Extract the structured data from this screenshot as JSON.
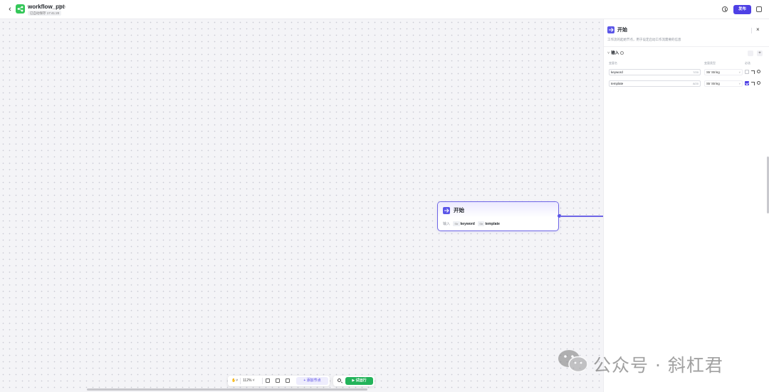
{
  "header": {
    "back_icon": "chevron-left-icon",
    "workflow_name": "workflow_ppt",
    "autosave_text": "已自动保存 17:41:20",
    "publish_label": "发布",
    "colors": {
      "publish": "#4e40e5",
      "app_icon": "#34c759"
    }
  },
  "canvas": {
    "start_node": {
      "title": "开始",
      "inputs_label": "输入",
      "inputs": [
        {
          "type_tag": "Str",
          "name": "keyword"
        },
        {
          "type_tag": "Str",
          "name": "template"
        }
      ]
    }
  },
  "toolbar": {
    "zoom": "112%",
    "add_node_label": "+ 添加节点",
    "test_run_label": "▶ 试运行",
    "colors": {
      "test_run": "#23b35a",
      "add_node_text": "#4e40e5"
    }
  },
  "panel": {
    "title": "开始",
    "close_label": "×",
    "description": "工作流的起始节点，用于设定启动工作流需要的信息",
    "section_title": "输入",
    "columns": {
      "name": "变量名",
      "type": "变量类型",
      "required": "必选"
    },
    "rows": [
      {
        "name": "keyword",
        "count": "7/20",
        "type": "String",
        "required": false
      },
      {
        "name": "template",
        "count": "8/20",
        "type": "String",
        "required": true
      }
    ]
  },
  "watermark": {
    "text": "公众号 · 斜杠君"
  }
}
